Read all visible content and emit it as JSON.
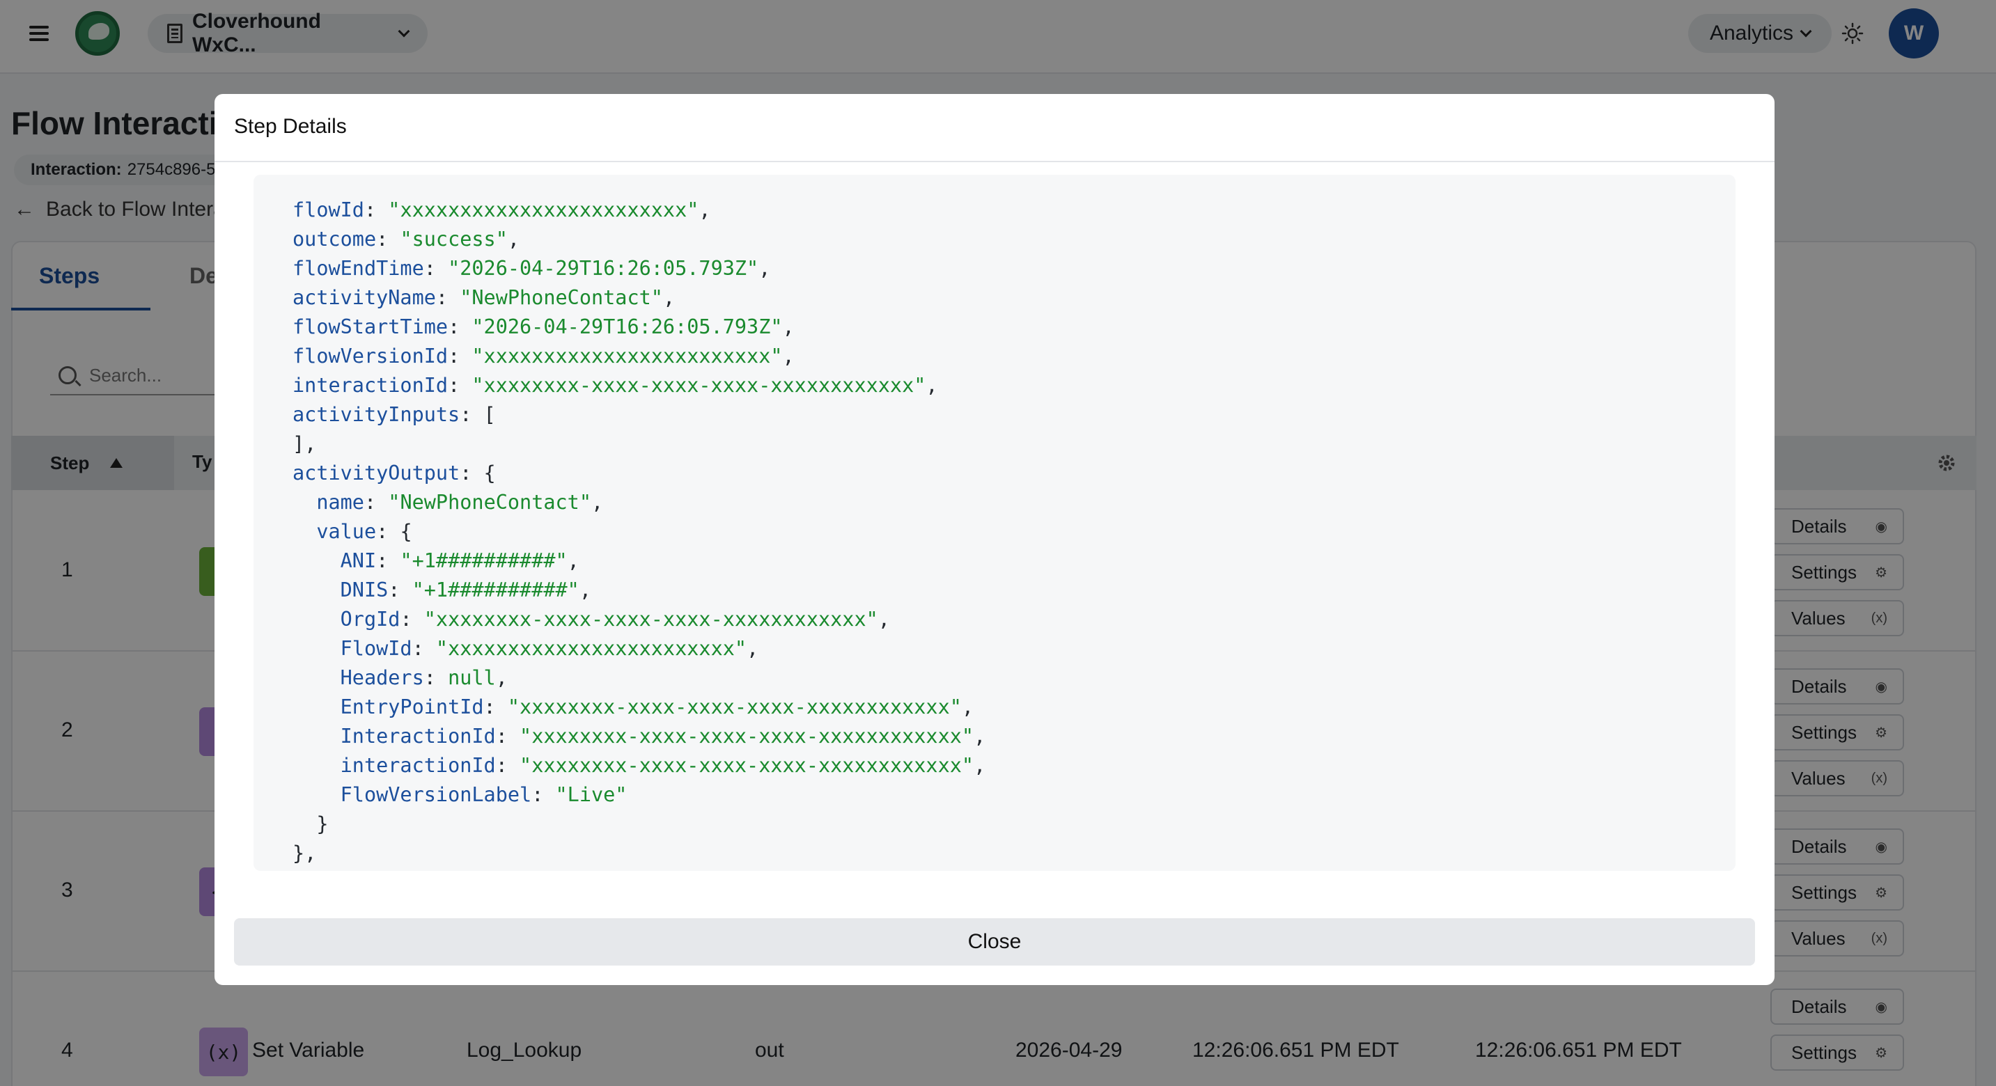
{
  "topbar": {
    "org_name": "Cloverhound WxC...",
    "analytics_label": "Analytics",
    "avatar_initial": "W"
  },
  "page": {
    "title": "Flow Interactic",
    "interaction_label": "Interaction:",
    "interaction_value": "2754c896-5",
    "back_link": "Back to Flow Intera"
  },
  "tabs": [
    {
      "label": "Steps"
    },
    {
      "label": "De"
    }
  ],
  "search": {
    "placeholder": "Search..."
  },
  "table": {
    "columns": {
      "step": "Step",
      "type": "Ty"
    },
    "rows": [
      {
        "step": "1",
        "badge_color": "#6bb33a",
        "badge_glyph": "⊖",
        "actions": [
          "Details",
          "Settings",
          "Values"
        ]
      },
      {
        "step": "2",
        "badge_color": "#b48ae0",
        "badge_glyph": "(x",
        "actions": [
          "Details",
          "Settings",
          "Values"
        ]
      },
      {
        "step": "3",
        "badge_color": "#b48ae0",
        "badge_glyph": "</",
        "actions": [
          "Details",
          "Settings",
          "Values"
        ]
      },
      {
        "step": "4",
        "badge_color": "#c9a6ec",
        "badge_glyph": "(x)",
        "type": "Set Variable",
        "name": "Log_Lookup",
        "direction": "out",
        "date": "2026-04-29",
        "start": "12:26:06.651 PM EDT",
        "end": "12:26:06.651 PM EDT",
        "actions": [
          "Details",
          "Settings"
        ]
      }
    ]
  },
  "modal": {
    "title": "Step Details",
    "close_label": "Close",
    "code_lines": [
      {
        "indent": 0,
        "key": "flowId",
        "value": "\"xxxxxxxxxxxxxxxxxxxxxxxx\"",
        "suffix": ","
      },
      {
        "indent": 0,
        "key": "outcome",
        "value": "\"success\"",
        "suffix": ","
      },
      {
        "indent": 0,
        "key": "flowEndTime",
        "value": "\"2026-04-29T16:26:05.793Z\"",
        "suffix": ","
      },
      {
        "indent": 0,
        "key": "activityName",
        "value": "\"NewPhoneContact\"",
        "suffix": ","
      },
      {
        "indent": 0,
        "key": "flowStartTime",
        "value": "\"2026-04-29T16:26:05.793Z\"",
        "suffix": ","
      },
      {
        "indent": 0,
        "key": "flowVersionId",
        "value": "\"xxxxxxxxxxxxxxxxxxxxxxxx\"",
        "suffix": ","
      },
      {
        "indent": 0,
        "key": "interactionId",
        "value": "\"xxxxxxxx-xxxx-xxxx-xxxx-xxxxxxxxxxxx\"",
        "suffix": ","
      },
      {
        "indent": 0,
        "key": "activityInputs",
        "value": "",
        "suffix": "["
      },
      {
        "indent": 0,
        "key": "",
        "value": "",
        "suffix": "],"
      },
      {
        "indent": 0,
        "key": "activityOutput",
        "value": "",
        "suffix": "{"
      },
      {
        "indent": 1,
        "key": "name",
        "value": "\"NewPhoneContact\"",
        "suffix": ","
      },
      {
        "indent": 1,
        "key": "value",
        "value": "",
        "suffix": "{"
      },
      {
        "indent": 2,
        "key": "ANI",
        "value": "\"+1##########\"",
        "suffix": ","
      },
      {
        "indent": 2,
        "key": "DNIS",
        "value": "\"+1##########\"",
        "suffix": ","
      },
      {
        "indent": 2,
        "key": "OrgId",
        "value": "\"xxxxxxxx-xxxx-xxxx-xxxx-xxxxxxxxxxxx\"",
        "suffix": ","
      },
      {
        "indent": 2,
        "key": "FlowId",
        "value": "\"xxxxxxxxxxxxxxxxxxxxxxxx\"",
        "suffix": ","
      },
      {
        "indent": 2,
        "key": "Headers",
        "value": "null",
        "suffix": ","
      },
      {
        "indent": 2,
        "key": "EntryPointId",
        "value": "\"xxxxxxxx-xxxx-xxxx-xxxx-xxxxxxxxxxxx\"",
        "suffix": ","
      },
      {
        "indent": 2,
        "key": "InteractionId",
        "value": "\"xxxxxxxx-xxxx-xxxx-xxxx-xxxxxxxxxxxx\"",
        "suffix": ","
      },
      {
        "indent": 2,
        "key": "interactionId",
        "value": "\"xxxxxxxx-xxxx-xxxx-xxxx-xxxxxxxxxxxx\"",
        "suffix": ","
      },
      {
        "indent": 2,
        "key": "FlowVersionLabel",
        "value": "\"Live\"",
        "suffix": ""
      },
      {
        "indent": 1,
        "key": "",
        "value": "",
        "suffix": "}"
      },
      {
        "indent": 0,
        "key": "",
        "value": "",
        "suffix": "},"
      }
    ]
  }
}
